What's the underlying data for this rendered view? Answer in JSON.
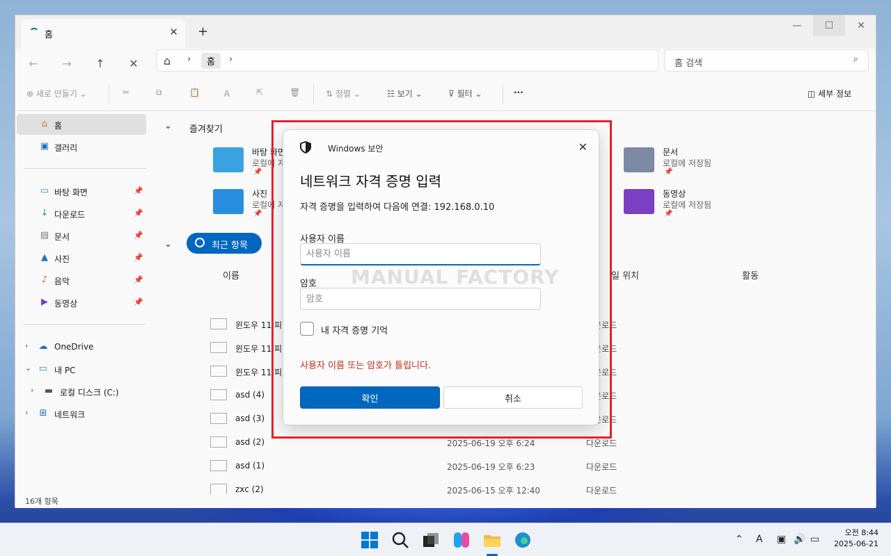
{
  "tab": {
    "title": "홈"
  },
  "address": {
    "crumb": "홈",
    "search_placeholder": "홈 검색"
  },
  "toolbar": {
    "new": "새로 만들기",
    "sort": "정렬",
    "view": "보기",
    "filter": "필터",
    "more": "···",
    "details": "세부 정보"
  },
  "sidebar": {
    "home": "홈",
    "gallery": "갤러리",
    "pinned": [
      {
        "label": "바탕 화면"
      },
      {
        "label": "다운로드"
      },
      {
        "label": "문서"
      },
      {
        "label": "사진"
      },
      {
        "label": "음악"
      },
      {
        "label": "동영상"
      }
    ],
    "onedrive": "OneDrive",
    "thispc": "내 PC",
    "localdisk": "로컬 디스크 (C:)",
    "network": "네트워크"
  },
  "main": {
    "favorites_title": "즐겨찾기",
    "quick": [
      {
        "name": "바탕 화면",
        "sub": "로컬에 저장됨"
      },
      {
        "name": "사진",
        "sub": "로컬에 저장됨"
      },
      {
        "name": "문서",
        "sub": "로컬에 저장됨"
      },
      {
        "name": "동영상",
        "sub": "로컬에 저장됨"
      }
    ],
    "recent_pill": "최근 항목",
    "col_name": "이름",
    "col_location": "일 위치",
    "col_activity": "활동",
    "rows": [
      {
        "name": "윈도우 11 피",
        "date": "",
        "loc": "다운로드"
      },
      {
        "name": "윈도우 11 피",
        "date": "",
        "loc": "다운로드"
      },
      {
        "name": "윈도우 11 피",
        "date": "",
        "loc": "다운로드"
      },
      {
        "name": "asd (4)",
        "date": "",
        "loc": "다운로드"
      },
      {
        "name": "asd (3)",
        "date": "",
        "loc": "다운로드"
      },
      {
        "name": "asd (2)",
        "date": "2025-06-19 오후 6:24",
        "loc": "다운로드"
      },
      {
        "name": "asd (1)",
        "date": "2025-06-19 오후 6:23",
        "loc": "다운로드"
      },
      {
        "name": "zxc (2)",
        "date": "2025-06-15 오후 12:40",
        "loc": "다운로드"
      }
    ]
  },
  "status": {
    "count": "16개 항목"
  },
  "dialog": {
    "app": "Windows 보안",
    "title": "네트워크 자격 증명 입력",
    "subtitle": "자격 증명을 입력하여 다음에 연결: 192.168.0.10",
    "user_label": "사용자 이름",
    "user_placeholder": "사용자 이름",
    "pass_label": "암호",
    "pass_placeholder": "암호",
    "remember": "내 자격 증명 기억",
    "error": "사용자 이름 또는 암호가 틀립니다.",
    "ok": "확인",
    "cancel": "취소"
  },
  "watermark": "MANUAL FACTORY",
  "clock": {
    "time": "오전 8:44",
    "date": "2025-06-21"
  },
  "colors": {
    "accent": "#0067c0",
    "error": "#c42b1c",
    "highlight": "#e8202a"
  }
}
